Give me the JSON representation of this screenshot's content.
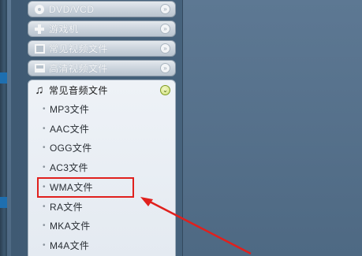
{
  "categories": [
    {
      "label": "DVD/VCD",
      "icon": "disc-icon"
    },
    {
      "label": "游戏机",
      "icon": "gamepad-icon"
    },
    {
      "label": "常见视频文件",
      "icon": "film-icon"
    },
    {
      "label": "高清视频文件",
      "icon": "hd-icon"
    }
  ],
  "expanded": {
    "label": "常见音频文件",
    "icon": "music-note-icon",
    "items": [
      "MP3文件",
      "AAC文件",
      "OGG文件",
      "AC3文件",
      "WMA文件",
      "RA文件",
      "MKA文件",
      "M4A文件"
    ]
  },
  "annotation": {
    "highlighted_item": "WMA文件",
    "color": "#e0201d"
  }
}
